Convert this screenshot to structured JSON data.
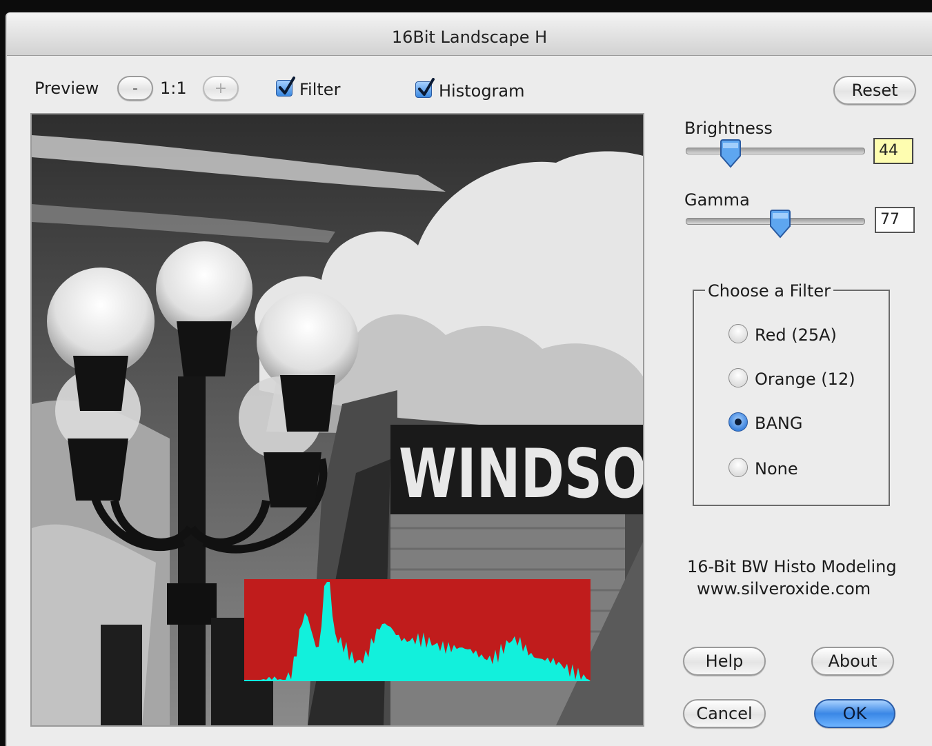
{
  "window": {
    "title": "16Bit Landscape H"
  },
  "toolbar": {
    "preview_label": "Preview",
    "zoom_out_label": "-",
    "zoom_value": "1:1",
    "zoom_in_label": "+",
    "filter_label": "Filter",
    "filter_checked": true,
    "histogram_label": "Histogram",
    "histogram_checked": true,
    "reset_label": "Reset"
  },
  "preview": {
    "sign_text": "WINDSO"
  },
  "histogram_colors": {
    "background": "#c01c1c",
    "fill": "#12f0dc"
  },
  "brightness": {
    "label": "Brightness",
    "value": "44",
    "level": 0.25
  },
  "gamma": {
    "label": "Gamma",
    "value": "77",
    "level": 0.53
  },
  "filter_group": {
    "title": "Choose a Filter",
    "options": [
      {
        "label": "Red (25A)",
        "selected": false
      },
      {
        "label": "Orange (12)",
        "selected": false
      },
      {
        "label": "BANG",
        "selected": true
      },
      {
        "label": "None",
        "selected": false
      }
    ]
  },
  "info": {
    "line1": "16-Bit BW Histo Modeling",
    "line2": "www.silveroxide.com"
  },
  "buttons": {
    "help": "Help",
    "about": "About",
    "cancel": "Cancel",
    "ok": "OK"
  }
}
